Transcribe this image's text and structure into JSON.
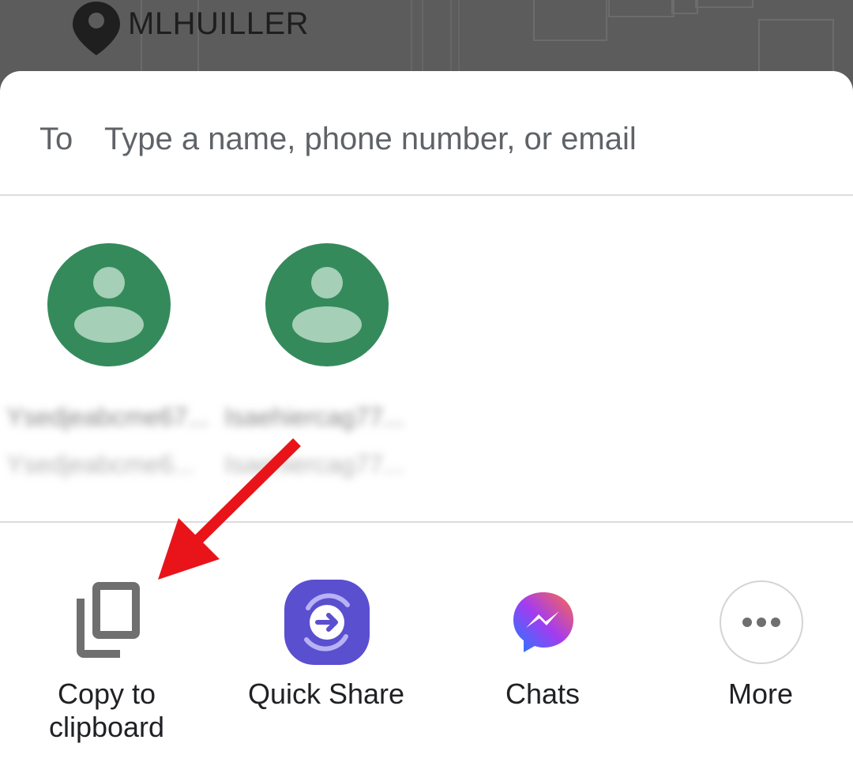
{
  "map": {
    "place_label": "MLHUILLER"
  },
  "share_sheet": {
    "to_label": "To",
    "to_placeholder": "Type a name, phone number, or email",
    "contacts": [
      {
        "name": "Ysedjeabcme67...",
        "detail": "Ysedjeabcme6..."
      },
      {
        "name": "Isaehiercag77...",
        "detail": "Isaehiercag77..."
      }
    ],
    "apps": [
      {
        "icon": "copy-icon",
        "label_line1": "Copy to",
        "label_line2": "clipboard"
      },
      {
        "icon": "quick-share-icon",
        "label_line1": "Quick Share"
      },
      {
        "icon": "messenger-icon",
        "label_line1": "Chats"
      },
      {
        "icon": "more-icon",
        "label_line1": "More"
      }
    ]
  },
  "colors": {
    "avatar_bg": "#358a5b",
    "quick_share": "#5a4fcf",
    "annotation_arrow": "#e8141a"
  }
}
